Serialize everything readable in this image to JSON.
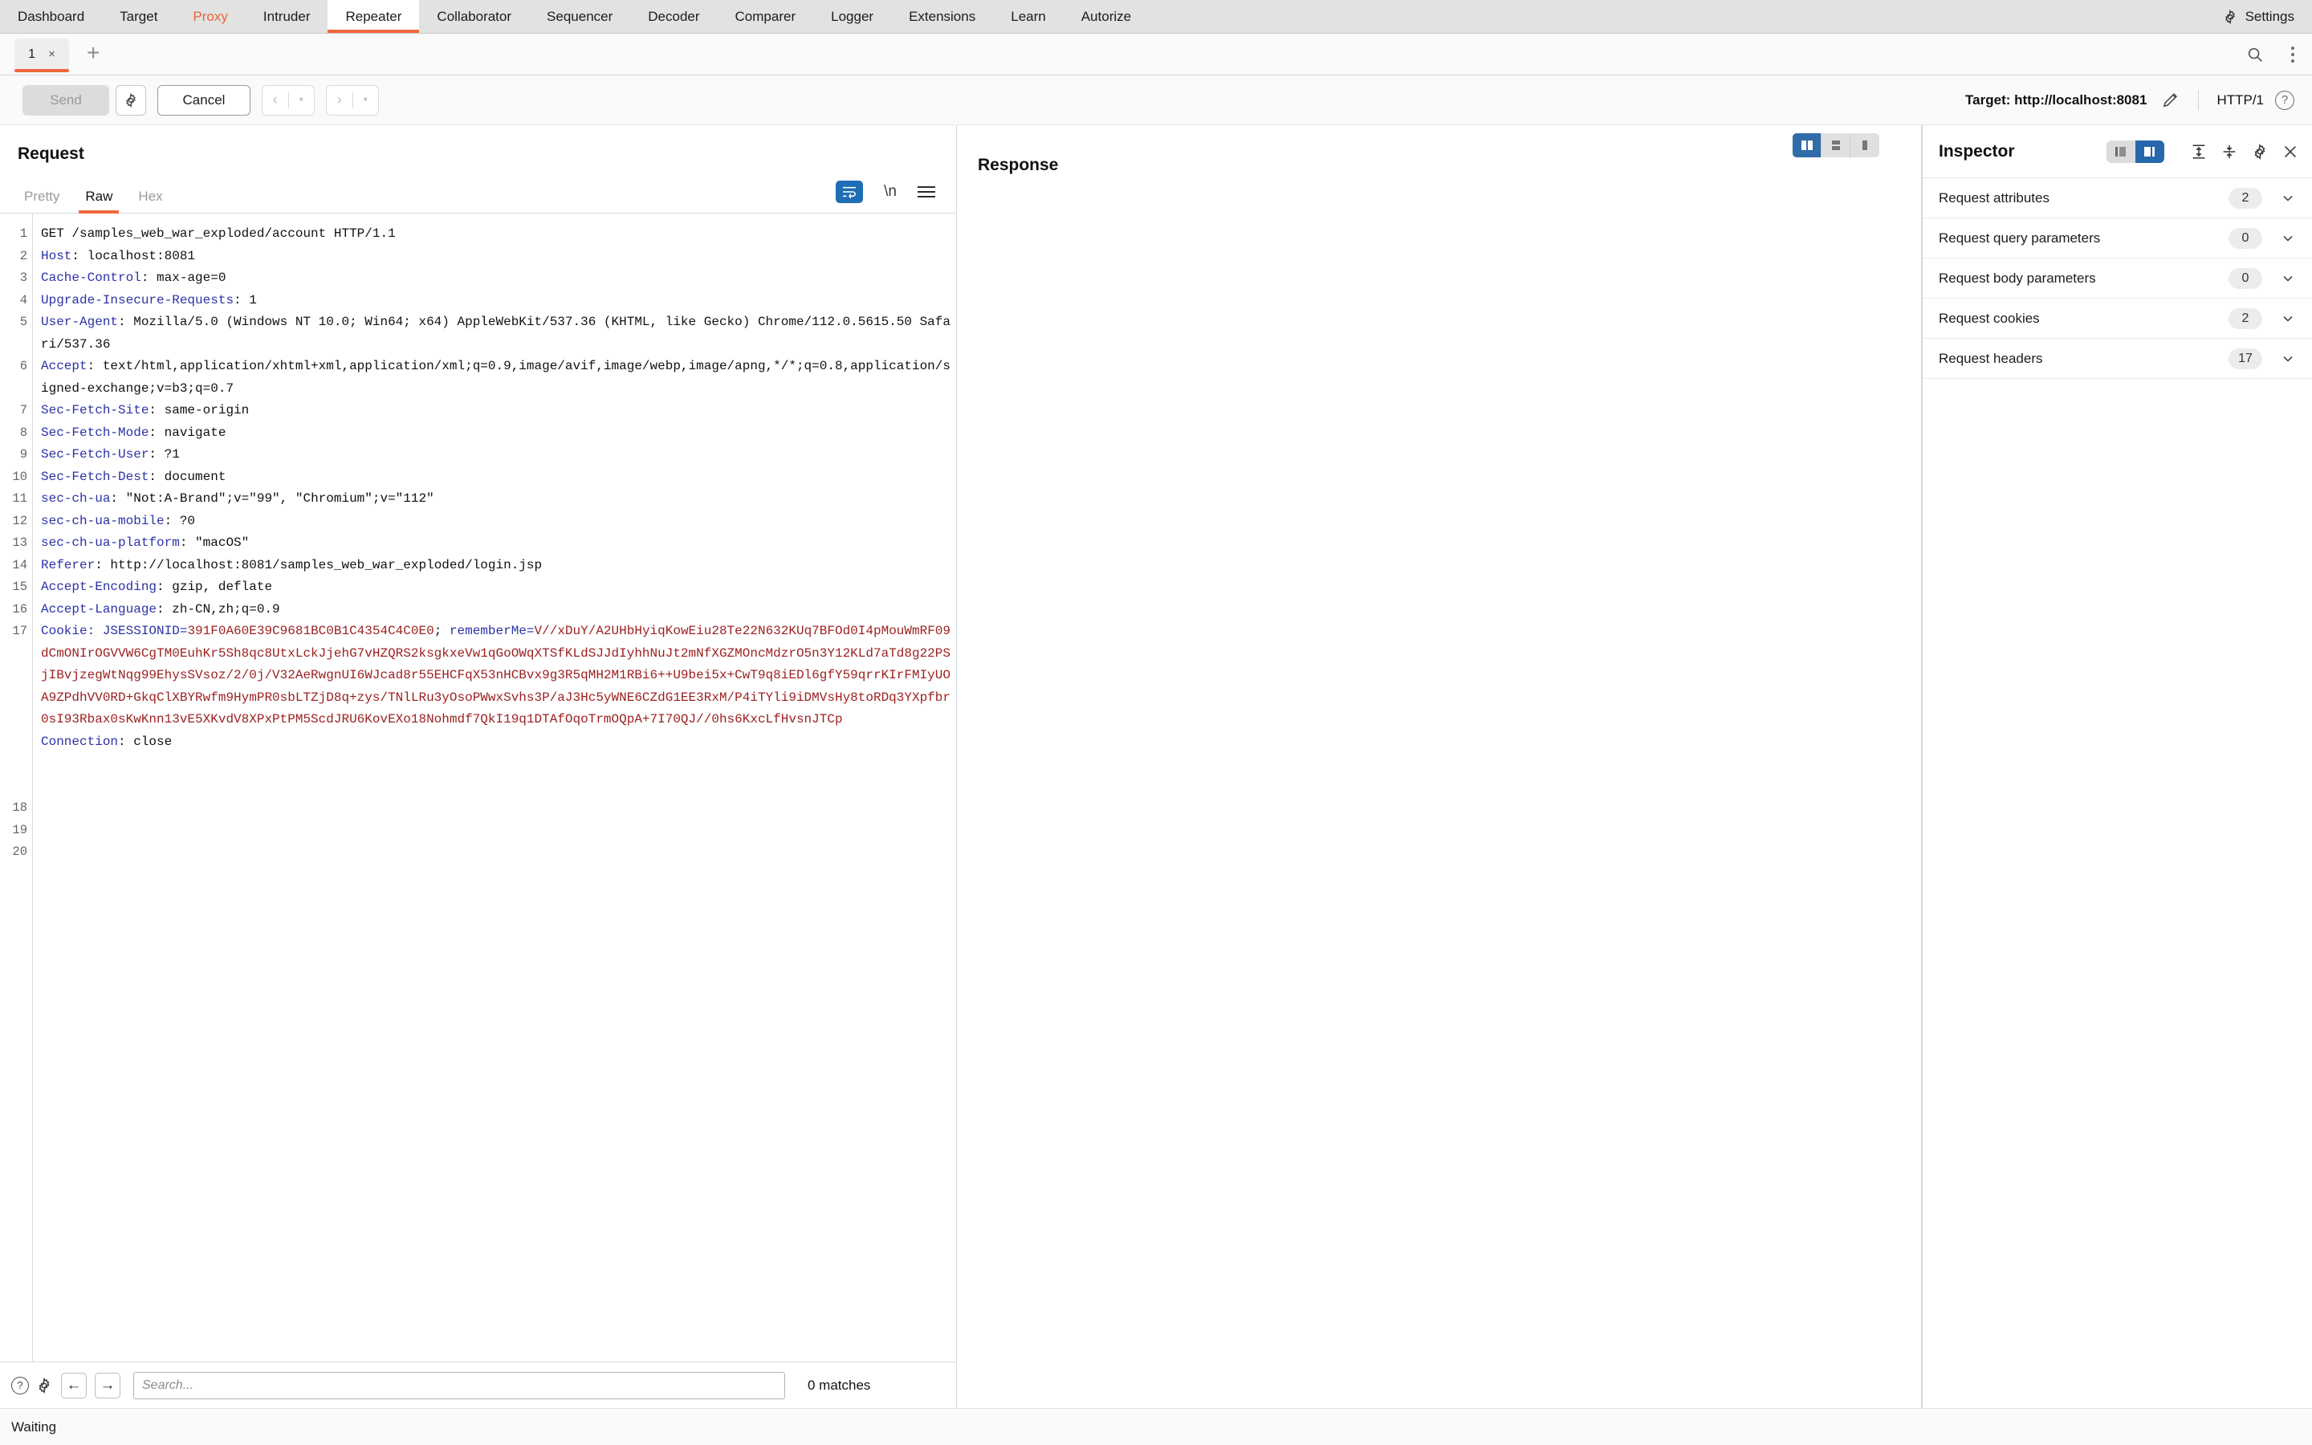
{
  "topnav": {
    "tabs": [
      {
        "label": "Dashboard",
        "state": "normal"
      },
      {
        "label": "Target",
        "state": "normal"
      },
      {
        "label": "Proxy",
        "state": "highlight"
      },
      {
        "label": "Intruder",
        "state": "normal"
      },
      {
        "label": "Repeater",
        "state": "active"
      },
      {
        "label": "Collaborator",
        "state": "normal"
      },
      {
        "label": "Sequencer",
        "state": "normal"
      },
      {
        "label": "Decoder",
        "state": "normal"
      },
      {
        "label": "Comparer",
        "state": "normal"
      },
      {
        "label": "Logger",
        "state": "normal"
      },
      {
        "label": "Extensions",
        "state": "normal"
      },
      {
        "label": "Learn",
        "state": "normal"
      },
      {
        "label": "Autorize",
        "state": "normal"
      }
    ],
    "settings_label": "Settings",
    "settings_icon": "gear-icon",
    "accent_color": "#f0673c",
    "proxy_color": "#e9643a"
  },
  "tabbar": {
    "session_tab_label": "1",
    "session_tab_close": "×",
    "add_tab_label": "+",
    "search_icon": "search-icon",
    "menu_icon": "kebab-menu-icon"
  },
  "actionbar": {
    "send_label": "Send",
    "send_disabled": true,
    "settings_icon": "gear-icon",
    "cancel_label": "Cancel",
    "prev_label": "‹",
    "next_label": "›",
    "caret": "▾",
    "target_label": "Target: http://localhost:8081",
    "edit_icon": "pencil-icon",
    "http_version": "HTTP/1",
    "help_label": "?"
  },
  "request": {
    "title": "Request",
    "tabs": [
      {
        "label": "Pretty",
        "active": false
      },
      {
        "label": "Raw",
        "active": true
      },
      {
        "label": "Hex",
        "active": false
      }
    ],
    "icons": [
      "word-wrap-icon",
      "newline-icon",
      "hamburger-menu-icon"
    ],
    "newline_label": "\\n",
    "line_numbers": [
      "1",
      "2",
      "3",
      "4",
      "5",
      "",
      "6",
      "",
      "",
      "7",
      "8",
      "9",
      "10",
      "11",
      "12",
      "13",
      "14",
      "15",
      "16",
      "17",
      "",
      "",
      "",
      "",
      "",
      "",
      "",
      "18",
      "19",
      "20"
    ],
    "lines": [
      {
        "n": 1,
        "type": "plain",
        "text": "GET /samples_web_war_exploded/account HTTP/1.1"
      },
      {
        "n": 2,
        "type": "header",
        "key": "Host",
        "value": "localhost:8081"
      },
      {
        "n": 3,
        "type": "header",
        "key": "Cache-Control",
        "value": "max-age=0"
      },
      {
        "n": 4,
        "type": "header",
        "key": "Upgrade-Insecure-Requests",
        "value": "1"
      },
      {
        "n": 5,
        "type": "header",
        "key": "User-Agent",
        "value": "Mozilla/5.0 (Windows NT 10.0; Win64; x64) AppleWebKit/537.36 (KHTML, like Gecko) Chrome/112.0.5615.50 Safari/537.36"
      },
      {
        "n": 6,
        "type": "header",
        "key": "Accept",
        "value": "text/html,application/xhtml+xml,application/xml;q=0.9,image/avif,image/webp,image/apng,*/*;q=0.8,application/signed-exchange;v=b3;q=0.7"
      },
      {
        "n": 7,
        "type": "header",
        "key": "Sec-Fetch-Site",
        "value": "same-origin"
      },
      {
        "n": 8,
        "type": "header",
        "key": "Sec-Fetch-Mode",
        "value": "navigate"
      },
      {
        "n": 9,
        "type": "header",
        "key": "Sec-Fetch-User",
        "value": "?1"
      },
      {
        "n": 10,
        "type": "header",
        "key": "Sec-Fetch-Dest",
        "value": "document"
      },
      {
        "n": 11,
        "type": "header",
        "key": "sec-ch-ua",
        "value": "\"Not:A-Brand\";v=\"99\", \"Chromium\";v=\"112\""
      },
      {
        "n": 12,
        "type": "header",
        "key": "sec-ch-ua-mobile",
        "value": "?0"
      },
      {
        "n": 13,
        "type": "header",
        "key": "sec-ch-ua-platform",
        "value": "\"macOS\""
      },
      {
        "n": 14,
        "type": "header",
        "key": "Referer",
        "value": "http://localhost:8081/samples_web_war_exploded/login.jsp"
      },
      {
        "n": 15,
        "type": "header",
        "key": "Accept-Encoding",
        "value": "gzip, deflate"
      },
      {
        "n": 16,
        "type": "header",
        "key": "Accept-Language",
        "value": "zh-CN,zh;q=0.9"
      },
      {
        "n": 17,
        "type": "cookie",
        "key": "Cookie"
      },
      {
        "n": 18,
        "type": "header",
        "key": "Connection",
        "value": "close"
      }
    ],
    "cookie": {
      "name1": "JSESSIONID",
      "value1": "391F0A60E39C9681BC0B1C4354C4C0E0",
      "sep": "; ",
      "name2": "rememberMe",
      "value2": "V//xDuY/A2UHbHyiqKowEiu28Te22N632KUq7BFOd0I4pMouWmRF09dCmONIrOGVVW6CgTM0EuhKr5Sh8qc8UtxLckJjehG7vHZQRS2ksgkxeVw1qGoOWqXTSfKLdSJJdIyhhNuJt2mNfXGZMOncMdzrO5n3Y12KLd7aTd8g22PSjIBvjzegWtNqg99EhysSVsoz/2/0j/V32AeRwgnUI6WJcad8r55EHCFqX53nHCBvx9g3R5qMH2M1RBi6++U9bei5x+CwT9q8iEDl6gfY59qrrKIrFMIyUOA9ZPdhVV0RD+GkqClXBYRwfm9HymPR0sbLTZjD8q+zys/TNlLRu3yOsoPWwxSvhs3P/aJ3Hc5yWNE6CZdG1EE3RxM/P4iTYli9iDMVsHy8toRDq3YXpfbr0sI93Rbax0sKwKnn13vE5XKvdV8XPxPtPM5ScdJRU6KovEXo18Nohmdf7QkI19q1DTAfOqoTrmOQpA+7I70QJ//0hs6KxcLfHvsnJTCp"
    },
    "search": {
      "help_icon": "help-circle-icon",
      "settings_icon": "gear-icon",
      "prev_icon": "arrow-left-icon",
      "next_icon": "arrow-right-icon",
      "placeholder": "Search...",
      "value": "",
      "matches_label": "0 matches"
    }
  },
  "response": {
    "title": "Response",
    "layout_buttons": [
      {
        "name": "side-by-side-layout-icon",
        "active": true
      },
      {
        "name": "stacked-layout-icon",
        "active": false
      },
      {
        "name": "single-pane-layout-icon",
        "active": false
      }
    ],
    "body_text": ""
  },
  "inspector": {
    "title": "Inspector",
    "toggle": [
      {
        "name": "inspector-left-layout-icon",
        "active": false
      },
      {
        "name": "inspector-right-layout-icon",
        "active": true
      }
    ],
    "icons": [
      "expand-all-icon",
      "collapse-all-icon",
      "gear-icon",
      "close-icon"
    ],
    "rows": [
      {
        "label": "Request attributes",
        "count": "2"
      },
      {
        "label": "Request query parameters",
        "count": "0"
      },
      {
        "label": "Request body parameters",
        "count": "0"
      },
      {
        "label": "Request cookies",
        "count": "2"
      },
      {
        "label": "Request headers",
        "count": "17"
      }
    ]
  },
  "statusbar": {
    "text": "Waiting"
  }
}
